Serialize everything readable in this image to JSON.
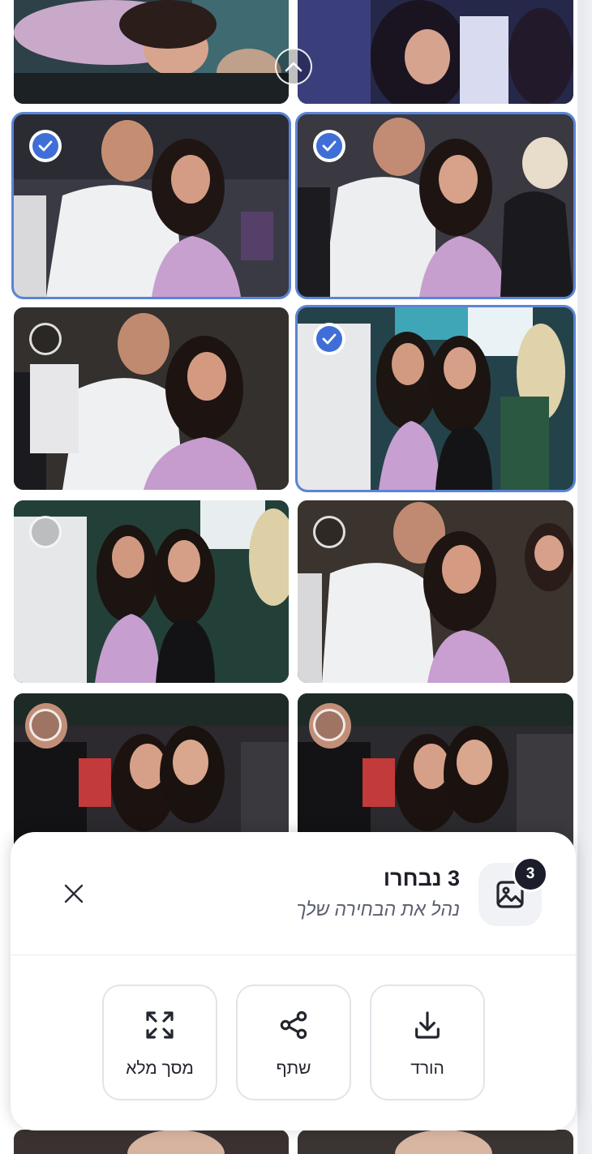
{
  "selection": {
    "count": "3",
    "title": "3 נבחרו",
    "subtitle": "נהל את הבחירה שלך"
  },
  "actions": [
    {
      "label": "הורד",
      "icon": "download-icon"
    },
    {
      "label": "שתף",
      "icon": "share-icon"
    },
    {
      "label": "מסך מלא",
      "icon": "fullscreen-icon"
    }
  ],
  "photos": [
    {
      "id": "photo-1",
      "selected": false
    },
    {
      "id": "photo-2",
      "selected": false
    },
    {
      "id": "photo-3",
      "selected": true
    },
    {
      "id": "photo-4",
      "selected": true
    },
    {
      "id": "photo-5",
      "selected": false
    },
    {
      "id": "photo-6",
      "selected": true
    },
    {
      "id": "photo-7",
      "selected": false
    },
    {
      "id": "photo-8",
      "selected": false
    },
    {
      "id": "photo-9",
      "selected": false
    },
    {
      "id": "photo-10",
      "selected": false
    }
  ],
  "colors": {
    "accent": "#3f6fd6",
    "selected_outline": "#5b84d6",
    "badge": "#1b1e2a"
  }
}
